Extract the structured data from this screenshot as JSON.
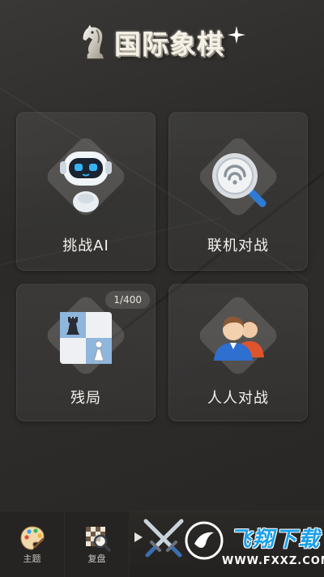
{
  "header": {
    "title": "国际象棋",
    "logo_icon": "chess-knight-icon",
    "sparkle_icon": "sparkle-icon"
  },
  "modes": {
    "ai": {
      "label": "挑战AI",
      "icon": "robot-icon"
    },
    "online": {
      "label": "联机对战",
      "icon": "online-search-icon"
    },
    "endgame": {
      "label": "残局",
      "icon": "chessboard-icon",
      "progress_text": "1/400"
    },
    "pvp": {
      "label": "人人对战",
      "icon": "two-people-icon"
    }
  },
  "bottom_nav": {
    "theme": {
      "label": "主题",
      "icon": "palette-icon"
    },
    "replay": {
      "label": "复盘",
      "icon": "board-magnifier-icon"
    },
    "play": {
      "icon": "crossed-swords-icon",
      "arrow_icon": "play-arrow-icon"
    }
  },
  "watermark": {
    "title": "飞翔下载",
    "url": "WWW.FXXZ.COM"
  },
  "colors": {
    "background": "#2e2c2a",
    "card": "#3b3936",
    "watermark_blue": "#1aa0e8",
    "robot_blue": "#2f9fe6",
    "people_blue": "#2f6fd0",
    "people_orange": "#e0542c"
  }
}
